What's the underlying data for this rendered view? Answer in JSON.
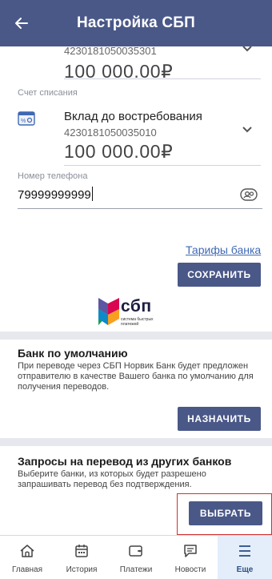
{
  "header": {
    "title": "Настройка СБП",
    "back_icon": "arrow-left-icon"
  },
  "top_account": {
    "number_clipped": "4230181050035301",
    "amount": "100 000.00₽"
  },
  "debit_account": {
    "label": "Счет списания",
    "title": "Вклад до востребования",
    "number": "4230181050035010",
    "amount": "100 000.00₽",
    "icon": "wallet-icon"
  },
  "phone": {
    "label": "Номер телефона",
    "value": "79999999999",
    "icon": "contacts-icon"
  },
  "links": {
    "tariffs": "Тарифы банка"
  },
  "buttons": {
    "save": "СОХРАНИТЬ",
    "assign": "НАЗНАЧИТЬ",
    "choose": "ВЫБРАТЬ"
  },
  "sbp_logo": {
    "text": "сбп",
    "subtext": "система быстрых платежей"
  },
  "default_bank": {
    "title": "Банк по умолчанию",
    "description": "При переводе через СБП Норвик Банк будет предложен отправителю в качестве Вашего банка по умолчанию для получения переводов."
  },
  "requests": {
    "title": "Запросы на перевод из других банков",
    "description": "Выберите банки, из которых будет разрешено запрашивать перевод без подтверждения."
  },
  "tabbar": {
    "items": [
      {
        "label": "Главная",
        "icon": "home-icon"
      },
      {
        "label": "История",
        "icon": "calendar-icon"
      },
      {
        "label": "Платежи",
        "icon": "payment-icon"
      },
      {
        "label": "Новости",
        "icon": "chat-icon"
      },
      {
        "label": "Еще",
        "icon": "menu-icon"
      }
    ],
    "active_index": 4
  },
  "colors": {
    "primary": "#4a5888",
    "link": "#3f69b3",
    "band": "#e6e8ee",
    "highlight": "#d32f2f",
    "active_tab_bg": "#e3eefa"
  }
}
